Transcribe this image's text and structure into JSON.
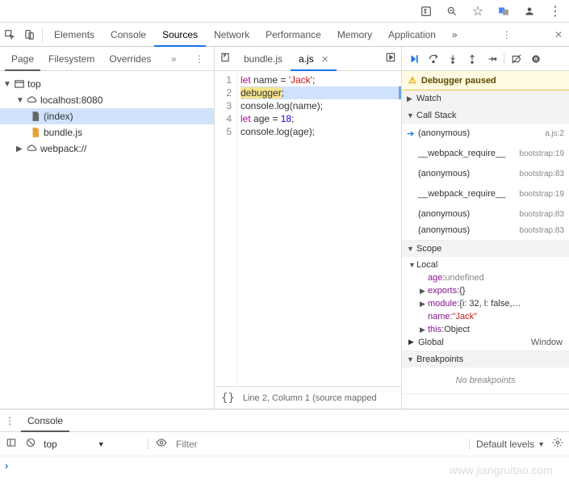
{
  "tabs": {
    "elements": "Elements",
    "console": "Console",
    "sources": "Sources",
    "network": "Network",
    "performance": "Performance",
    "memory": "Memory",
    "application": "Application"
  },
  "left_tabs": {
    "page": "Page",
    "filesystem": "Filesystem",
    "overrides": "Overrides"
  },
  "tree": {
    "top": "top",
    "host": "localhost:8080",
    "index": "(index)",
    "bundle": "bundle.js",
    "webpack": "webpack://"
  },
  "file_tabs": {
    "bundle": "bundle.js",
    "a": "a.js"
  },
  "code": {
    "l1_kw": "let",
    "l1_rest": " name = ",
    "l1_str": "'Jack'",
    "l1_end": ";",
    "l2_dbg": "debugger",
    "l2_end": ";",
    "l3": "console.log(name);",
    "l4_kw": "let",
    "l4_rest": " age = ",
    "l4_num": "18",
    "l4_end": ";",
    "l5": "console.log(age);"
  },
  "gutter": {
    "1": "1",
    "2": "2",
    "3": "3",
    "4": "4",
    "5": "5"
  },
  "status": "Line 2, Column 1 (source mapped",
  "paused": "Debugger paused",
  "panels": {
    "watch": "Watch",
    "callstack": "Call Stack",
    "scope": "Scope",
    "breakpoints": "Breakpoints",
    "local": "Local",
    "global": "Global",
    "window": "Window",
    "nobp": "No breakpoints"
  },
  "stack": [
    {
      "fn": "(anonymous)",
      "loc": "a.js:2",
      "ptr": true
    },
    {
      "fn": "__webpack_require__",
      "loc": "bootstrap:19"
    },
    {
      "fn": "(anonymous)",
      "loc": "bootstrap:83"
    },
    {
      "fn": "__webpack_require__",
      "loc": "bootstrap:19"
    },
    {
      "fn": "(anonymous)",
      "loc": "bootstrap:83"
    },
    {
      "fn": "(anonymous)",
      "loc": "bootstrap:83"
    }
  ],
  "scope": {
    "age_k": "age",
    "age_v": "undefined",
    "exports_k": "exports",
    "exports_v": "{}",
    "module_k": "module",
    "module_v": "{i: 32, l: false,…",
    "name_k": "name",
    "name_v": "\"Jack\"",
    "this_k": "this",
    "this_v": "Object"
  },
  "console": {
    "label": "Console",
    "context": "top",
    "filter_ph": "Filter",
    "levels": "Default levels"
  },
  "watermark": "www.jiangruitao.com"
}
